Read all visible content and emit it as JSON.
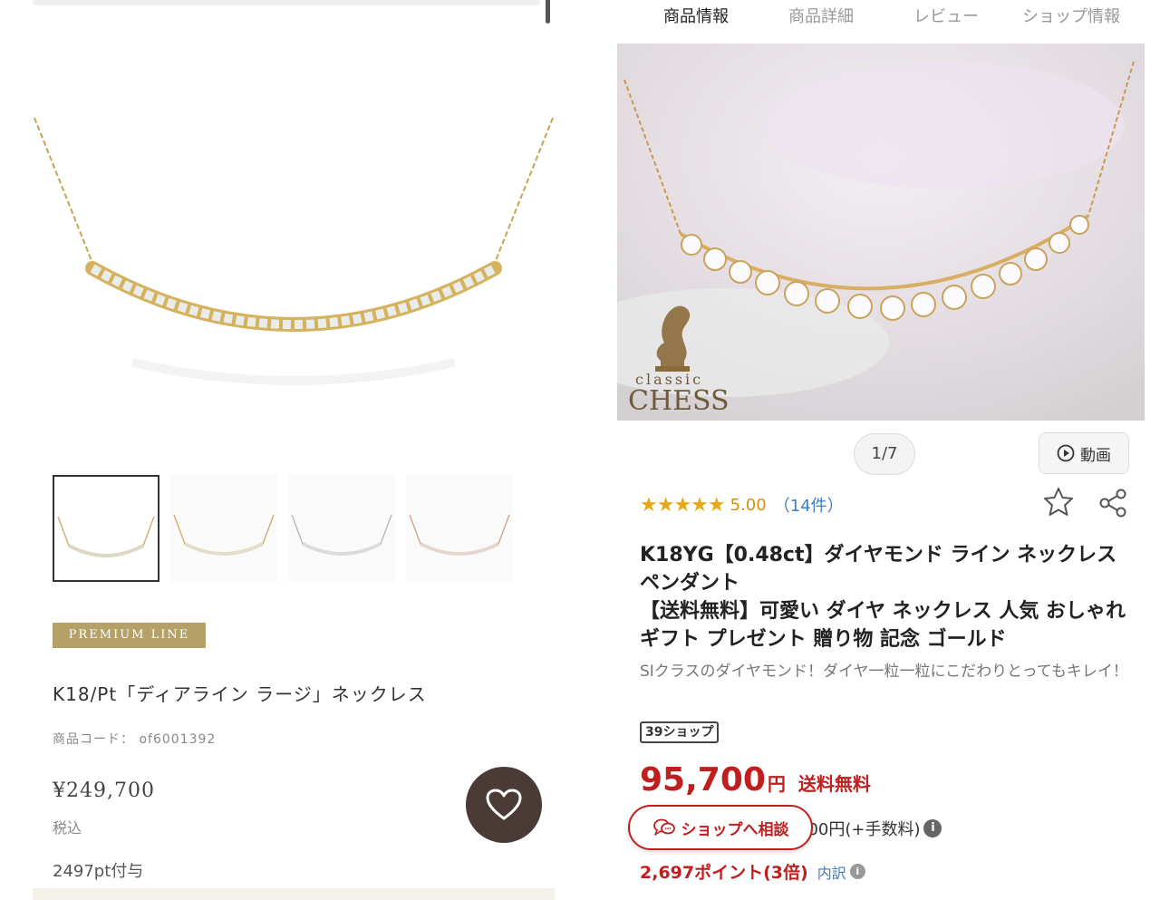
{
  "left": {
    "label": "PREMIUM LINE",
    "product_title": "K18/Pt「ディアライン ラージ」ネックレス",
    "product_code": "商品コード： of6001392",
    "price": "¥249,700",
    "tax_note": "税込",
    "points": "2497pt付与",
    "thumb_count": 4
  },
  "right": {
    "tabs": [
      "商品情報",
      "商品詳細",
      "レビュー",
      "ショップ情報"
    ],
    "active_tab": 0,
    "image_counter": "1/7",
    "video_label": "動画",
    "logo_small": "classic",
    "logo_big": "CHESS",
    "rating": {
      "stars": "★★★★★",
      "score": "5.00",
      "count": "（14件）",
      "value": 5.0
    },
    "title_line1": "K18YG【0.48ct】ダイヤモンド ライン ネックレス ペンダント",
    "title_line2": "【送料無料】可愛い ダイヤ ネックレス 人気 おしゃれ ギフト プレゼント 贈り物 記念 ゴールド",
    "catchcopy": "SIクラスのダイヤモンド！ダイヤ一粒一粒にこだわりとってもキレイ！",
    "badge": "39ショップ",
    "price": "95,700",
    "price_unit": "円",
    "shipping": "送料無料",
    "payment_partial": "900円(+手数料)",
    "consult_label": "ショップへ相談",
    "points": "2,697ポイント(3倍)",
    "breakdown_label": "内訳"
  },
  "colors": {
    "accent_red": "#bf1f1f",
    "star_gold": "#e6a817",
    "link_blue": "#3b7dc4",
    "premium_gold": "#b5a067",
    "fav_button": "#4a3b36"
  }
}
